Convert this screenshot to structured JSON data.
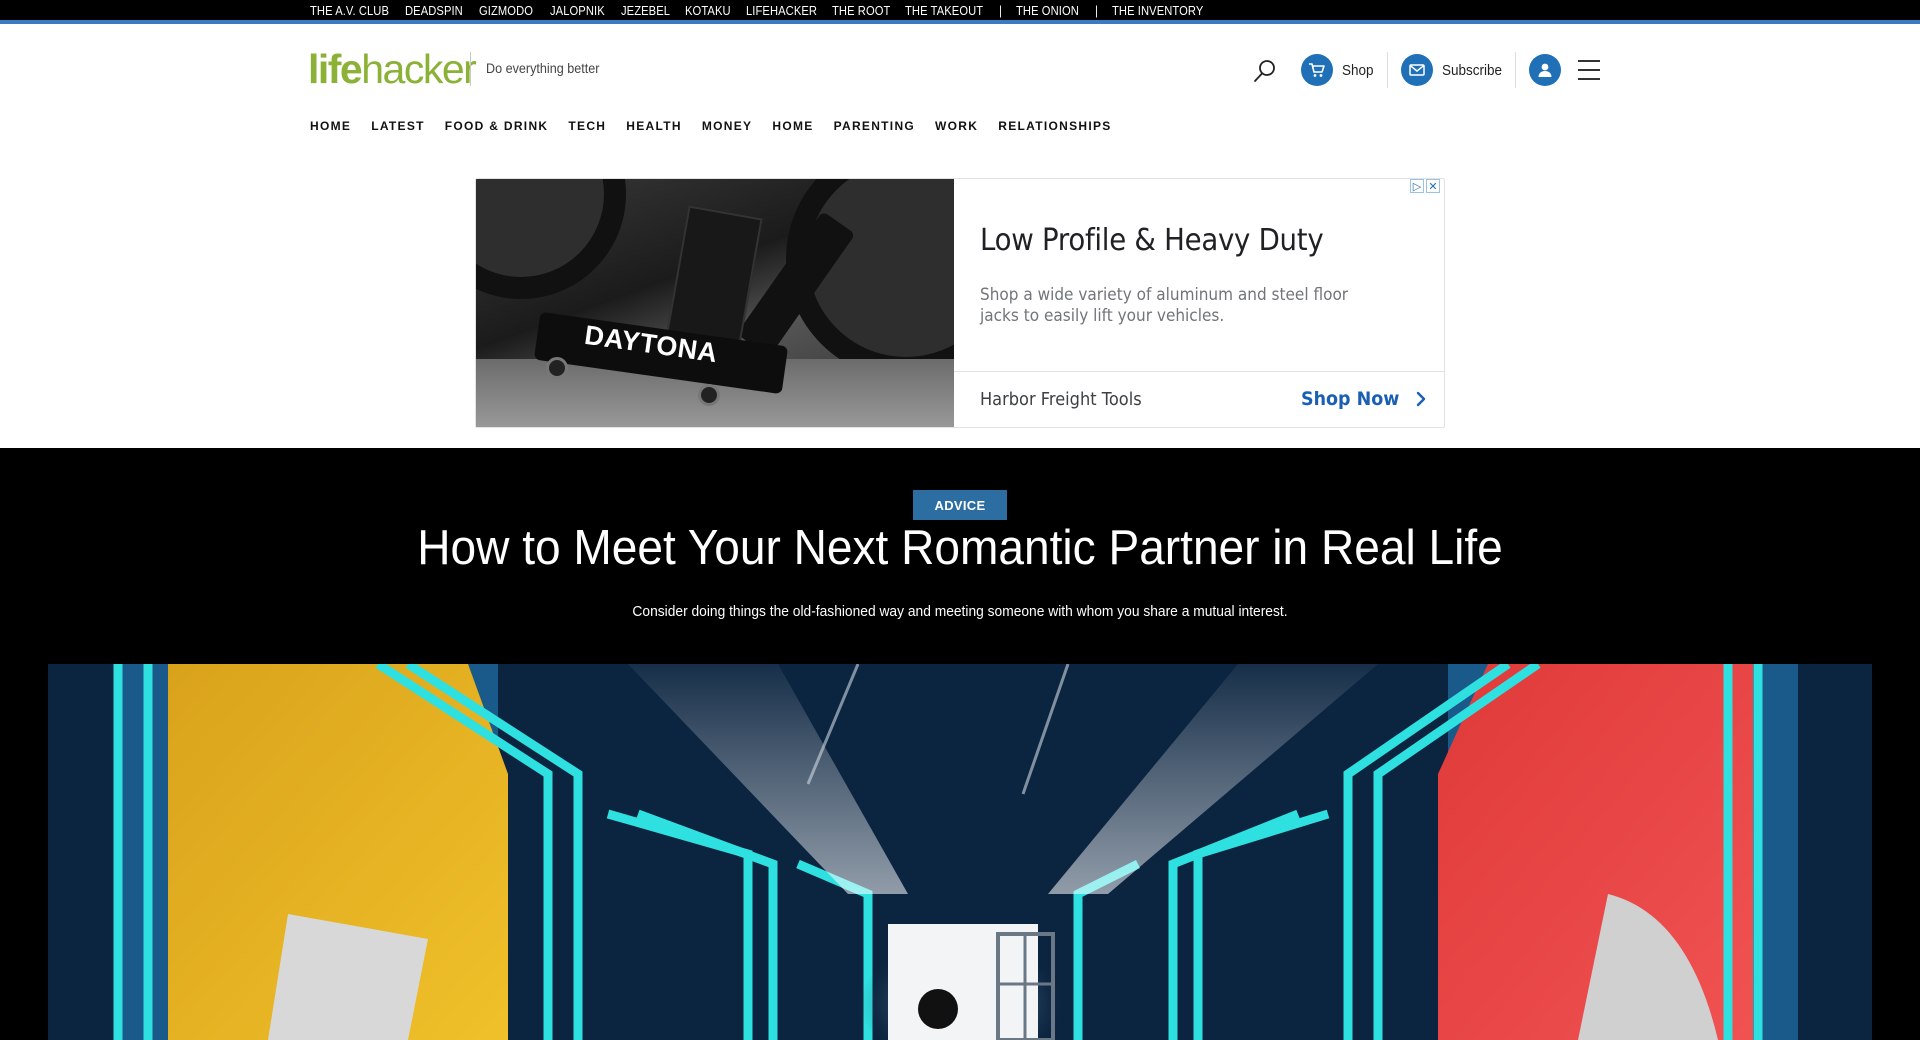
{
  "network": {
    "links": [
      "THE A.V. CLUB",
      "DEADSPIN",
      "GIZMODO",
      "JALOPNIK",
      "JEZEBEL",
      "KOTAKU",
      "LIFEHACKER",
      "THE ROOT",
      "THE TAKEOUT"
    ],
    "separator": "|",
    "extra_links": [
      "THE ONION",
      "THE INVENTORY"
    ]
  },
  "header": {
    "logo_life": "life",
    "logo_hacker": "hacker",
    "tagline": "Do everything better",
    "shop_label": "Shop",
    "subscribe_label": "Subscribe"
  },
  "nav": {
    "items": [
      "HOME",
      "LATEST",
      "FOOD & DRINK",
      "TECH",
      "HEALTH",
      "MONEY",
      "HOME",
      "PARENTING",
      "WORK",
      "RELATIONSHIPS"
    ]
  },
  "ad": {
    "brand_on_image": "DAYTONA",
    "headline": "Low Profile & Heavy Duty",
    "body": "Shop a wide variety of aluminum and steel floor jacks to easily lift your vehicles.",
    "advertiser": "Harbor Freight Tools",
    "cta": "Shop Now"
  },
  "article": {
    "category": "ADVICE",
    "title": "How to Meet Your Next Romantic Partner in Real Life",
    "subtitle": "Consider doing things the old-fashioned way and meeting someone with whom you share a mutual interest."
  },
  "colors": {
    "brand_green": "#8bb137",
    "accent_blue": "#1f70b6",
    "category_blue": "#2d6ea2",
    "network_bar": "#000000"
  }
}
